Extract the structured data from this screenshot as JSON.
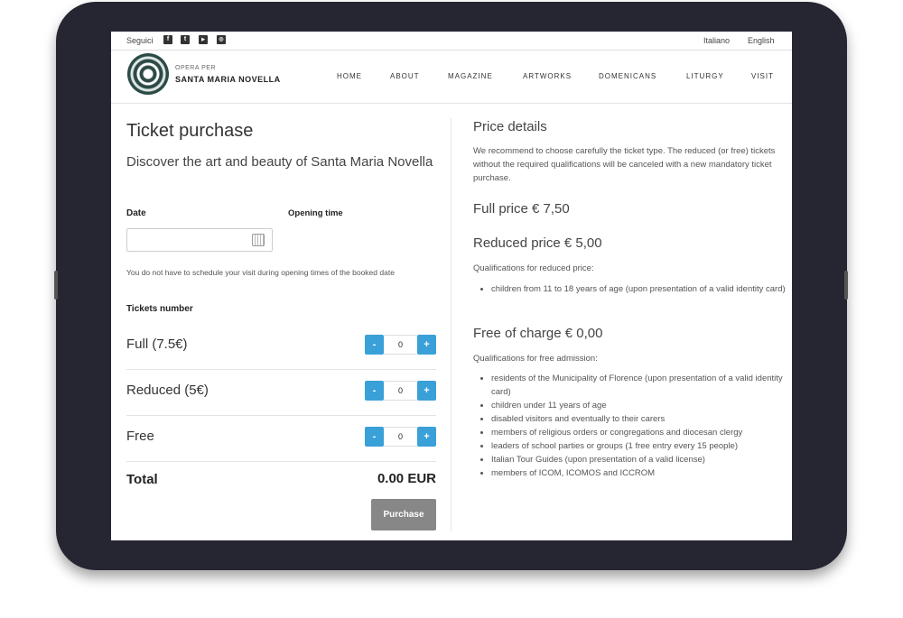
{
  "topbar": {
    "follow": "Seguici",
    "social": [
      "facebook-icon",
      "twitter-icon",
      "youtube-icon",
      "instagram-icon"
    ],
    "languages": [
      "Italiano",
      "English"
    ]
  },
  "logo": {
    "line1": "OPERA PER",
    "line2": "SANTA MARIA NOVELLA"
  },
  "nav": [
    "HOME",
    "ABOUT",
    "MAGAZINE",
    "ARTWORKS",
    "DOMENICANS",
    "LITURGY",
    "VISIT"
  ],
  "left": {
    "title": "Ticket purchase",
    "subtitle": "Discover the art and beauty of Santa Maria Novella",
    "date_label": "Date",
    "opening_label": "Opening time",
    "date_value": "",
    "note": "You do not have to schedule your visit during opening times of the booked date",
    "tickets_label": "Tickets number",
    "tickets": [
      {
        "name": "Full (7.5€)",
        "qty": "0"
      },
      {
        "name": "Reduced (5€)",
        "qty": "0"
      },
      {
        "name": "Free",
        "qty": "0"
      }
    ],
    "minus": "-",
    "plus": "+",
    "total_label": "Total",
    "total_value": "0.00 EUR",
    "purchase": "Purchase"
  },
  "right": {
    "title": "Price details",
    "intro": "We recommend to choose carefully the ticket type. The reduced (or free) tickets without the required qualifications will be canceled with a new mandatory ticket purchase.",
    "full": "Full price € 7,50",
    "reduced": "Reduced price € 5,00",
    "reduced_q": "Qualifications for reduced price:",
    "reduced_items": [
      "children from 11 to 18 years of age (upon presentation of a valid identity card)"
    ],
    "free": "Free of charge € 0,00",
    "free_q": "Qualifications for free admission:",
    "free_items": [
      "residents of the Municipality of Florence (upon presentation of a valid identity card)",
      "children under 11 years of age",
      "disabled visitors and eventually to their carers",
      "members of religious orders or congregations and diocesan clergy",
      "leaders of school parties or groups (1 free entry every 15 people)",
      "Italian Tour Guides (upon presentation of a valid license)",
      "members of ICOM, ICOMOS and ICCROM"
    ]
  },
  "colors": {
    "accent": "#3aa0d8",
    "button": "#878787",
    "frame": "#262633"
  }
}
